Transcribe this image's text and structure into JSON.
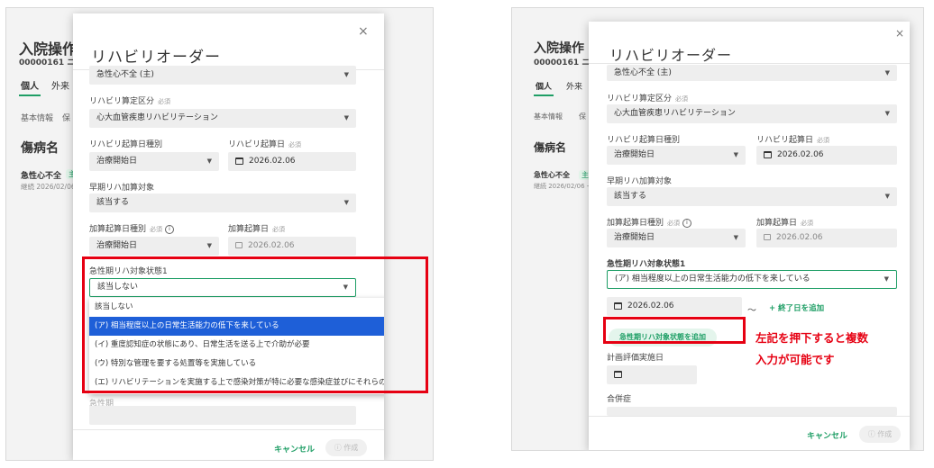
{
  "background": {
    "title": "入院操作",
    "patient_code": "00000161",
    "patient_name_fragment": "ニ",
    "tabs": [
      "個人",
      "外来"
    ],
    "subtabs": [
      "基本情報",
      "保"
    ],
    "section_title": "傷病名",
    "disease": "急性心不全",
    "disease_badge": "主",
    "disease_meta": "継続 2026/02/06 -"
  },
  "modal": {
    "title": "リハビリオーダー",
    "close_icon": "×",
    "top_field_value": "急性心不全 (主)",
    "rehab_category_label": "リハビリ算定区分",
    "required": "必須",
    "rehab_category_value": "心大血管疾患リハビリテーション",
    "start_date_type_label": "リハビリ起算日種別",
    "start_date_type_value": "治療開始日",
    "start_date_label": "リハビリ起算日",
    "start_date_value": "2026.02.06",
    "early_label": "早期リハ加算対象",
    "early_value": "該当する",
    "add_start_type_label": "加算起算日種別",
    "add_start_type_value": "治療開始日",
    "add_start_date_label": "加算起算日",
    "add_start_date_value": "2026.02.06",
    "acute_label": "急性期リハ対象状態1",
    "cancel": "キャンセル",
    "create": "作成"
  },
  "left": {
    "acute_value": "該当しない",
    "dropdown_options": [
      "該当しない",
      "(ア) 相当程度以上の日常生活能力の低下を来している",
      "(イ) 重度認知症の状態にあり、日常生活を送る上で介助が必要",
      "(ウ) 特別な管理を要する処置等を実施している",
      "(エ) リハビリテーションを実施する上で感染対策が特に必要な感染症並びにそれらの疑似症患者"
    ],
    "selected_index": 1,
    "hidden_label_fragment": "急性期"
  },
  "right": {
    "acute_value": "(ア) 相当程度以上の日常生活能力の低下を来している",
    "acute_date": "2026.02.06",
    "tilde": "〜",
    "add_end_date": "+ 終了日を追加",
    "add_acute_button": "急性期リハ対象状態を追加",
    "eval_label": "計画評価実施日",
    "comorbid_label": "合併症",
    "note_line1": "左記を押下すると複数",
    "note_line2": "入力が可能です"
  }
}
